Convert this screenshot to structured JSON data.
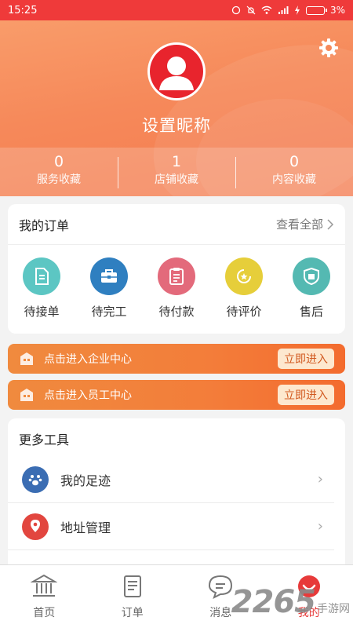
{
  "status_bar": {
    "time": "15:25",
    "signal": "4G",
    "battery": "3%"
  },
  "profile": {
    "nickname": "设置昵称"
  },
  "stats": [
    {
      "value": "0",
      "label": "服务收藏"
    },
    {
      "value": "1",
      "label": "店铺收藏"
    },
    {
      "value": "0",
      "label": "内容收藏"
    }
  ],
  "orders": {
    "title": "我的订单",
    "view_all": "查看全部",
    "items": [
      {
        "label": "待接单",
        "icon": "document-icon",
        "color": "#5cc6c3"
      },
      {
        "label": "待完工",
        "icon": "toolbox-icon",
        "color": "#2f7fc0"
      },
      {
        "label": "待付款",
        "icon": "clipboard-icon",
        "color": "#e36a7b"
      },
      {
        "label": "待评价",
        "icon": "star-badge-icon",
        "color": "#e6ce3a"
      },
      {
        "label": "售后",
        "icon": "after-sale-icon",
        "color": "#54b9b2"
      }
    ]
  },
  "banners": [
    {
      "text": "点击进入企业中心",
      "button": "立即进入"
    },
    {
      "text": "点击进入员工中心",
      "button": "立即进入"
    }
  ],
  "tools": {
    "title": "更多工具",
    "items": [
      {
        "label": "我的足迹",
        "icon": "paw-icon",
        "color": "#3b6db3"
      },
      {
        "label": "地址管理",
        "icon": "location-pin-icon",
        "color": "#e2463f"
      }
    ]
  },
  "tabbar": [
    {
      "label": "首页",
      "icon": "home-bank-icon",
      "active": false
    },
    {
      "label": "订单",
      "icon": "order-list-icon",
      "active": false
    },
    {
      "label": "消息",
      "icon": "message-bubble-icon",
      "active": false
    },
    {
      "label": "我的",
      "icon": "profile-smile-icon",
      "active": true
    }
  ],
  "watermark": {
    "number": "2265",
    "text": "手游网"
  },
  "colors": {
    "primary": "#ef3a3a",
    "header": "#f6895a",
    "banner": "#f37d3a"
  }
}
